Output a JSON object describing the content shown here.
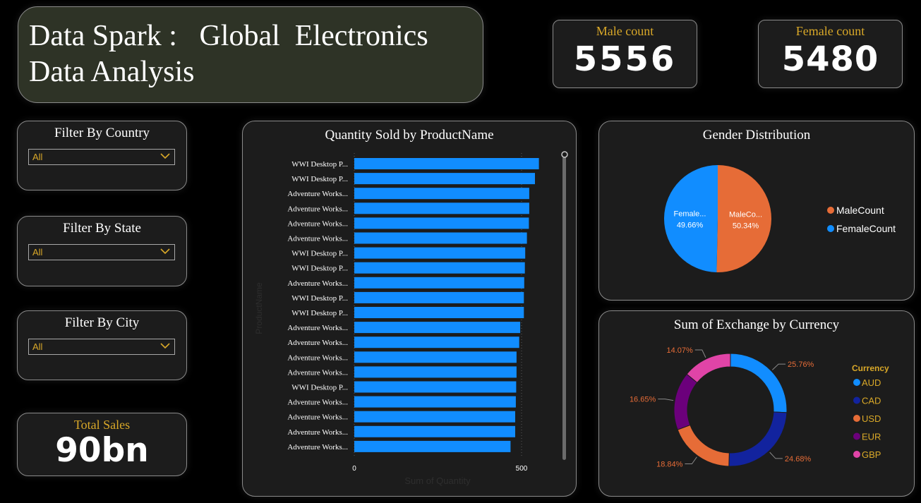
{
  "header": {
    "title_line1": "Data Spark :   Global  Electronics",
    "title_line2": "Data Analysis"
  },
  "kpis": {
    "male_label": "Male count",
    "male_value": "5556",
    "female_label": "Female count",
    "female_value": "5480",
    "total_sales_label": "Total Sales",
    "total_sales_value": "90bn"
  },
  "filters": {
    "country": {
      "title": "Filter By Country",
      "value": "All"
    },
    "state": {
      "title": "Filter By State",
      "value": "All"
    },
    "city": {
      "title": "Filter By City",
      "value": "All"
    }
  },
  "icons": {
    "dropdown": "chevron-down-icon",
    "scroll": "scroll-thumb-icon"
  },
  "colors": {
    "accent_gold": "#d9a828",
    "bar_blue": "#118dff",
    "male_orange": "#e66c37",
    "female_blue": "#118dff",
    "aud": "#118dff",
    "cad": "#12239e",
    "usd": "#e66c37",
    "eur": "#6b007b",
    "gbp": "#e044a7"
  },
  "chart_data": [
    {
      "type": "bar",
      "orientation": "horizontal",
      "title": "Quantity Sold by ProductName",
      "xlabel": "Sum of Quantity",
      "ylabel": "ProductName",
      "xticks": [
        "0",
        "500"
      ],
      "xlim": [
        0,
        560
      ],
      "categories": [
        "WWI Desktop P...",
        "WWI Desktop P...",
        "Adventure Works...",
        "Adventure Works...",
        "Adventure Works...",
        "Adventure Works...",
        "WWI Desktop P...",
        "WWI Desktop P...",
        "Adventure Works...",
        "WWI Desktop P...",
        "WWI Desktop P...",
        "Adventure Works...",
        "Adventure Works...",
        "Adventure Works...",
        "Adventure Works...",
        "WWI Desktop P...",
        "Adventure Works...",
        "Adventure Works...",
        "Adventure Works...",
        "Adventure Works..."
      ],
      "values": [
        552,
        540,
        523,
        523,
        522,
        516,
        511,
        510,
        508,
        507,
        507,
        496,
        493,
        485,
        485,
        484,
        483,
        481,
        481,
        467
      ]
    },
    {
      "type": "pie",
      "title": "Gender Distribution",
      "labels": [
        "MaleCount",
        "FemaleCount"
      ],
      "slice_labels": [
        "MaleCo...",
        "Female..."
      ],
      "values": [
        50.34,
        49.66
      ],
      "value_labels": [
        "50.34%",
        "49.66%"
      ],
      "legend_position": "right"
    },
    {
      "type": "pie",
      "variant": "donut",
      "title": "Sum of Exchange by Currency",
      "legend_title": "Currency",
      "labels": [
        "AUD",
        "CAD",
        "USD",
        "EUR",
        "GBP"
      ],
      "values": [
        25.76,
        24.68,
        18.84,
        16.65,
        14.07
      ],
      "value_labels": [
        "25.76%",
        "24.68%",
        "18.84%",
        "16.65%",
        "14.07%"
      ],
      "legend_position": "right"
    }
  ]
}
